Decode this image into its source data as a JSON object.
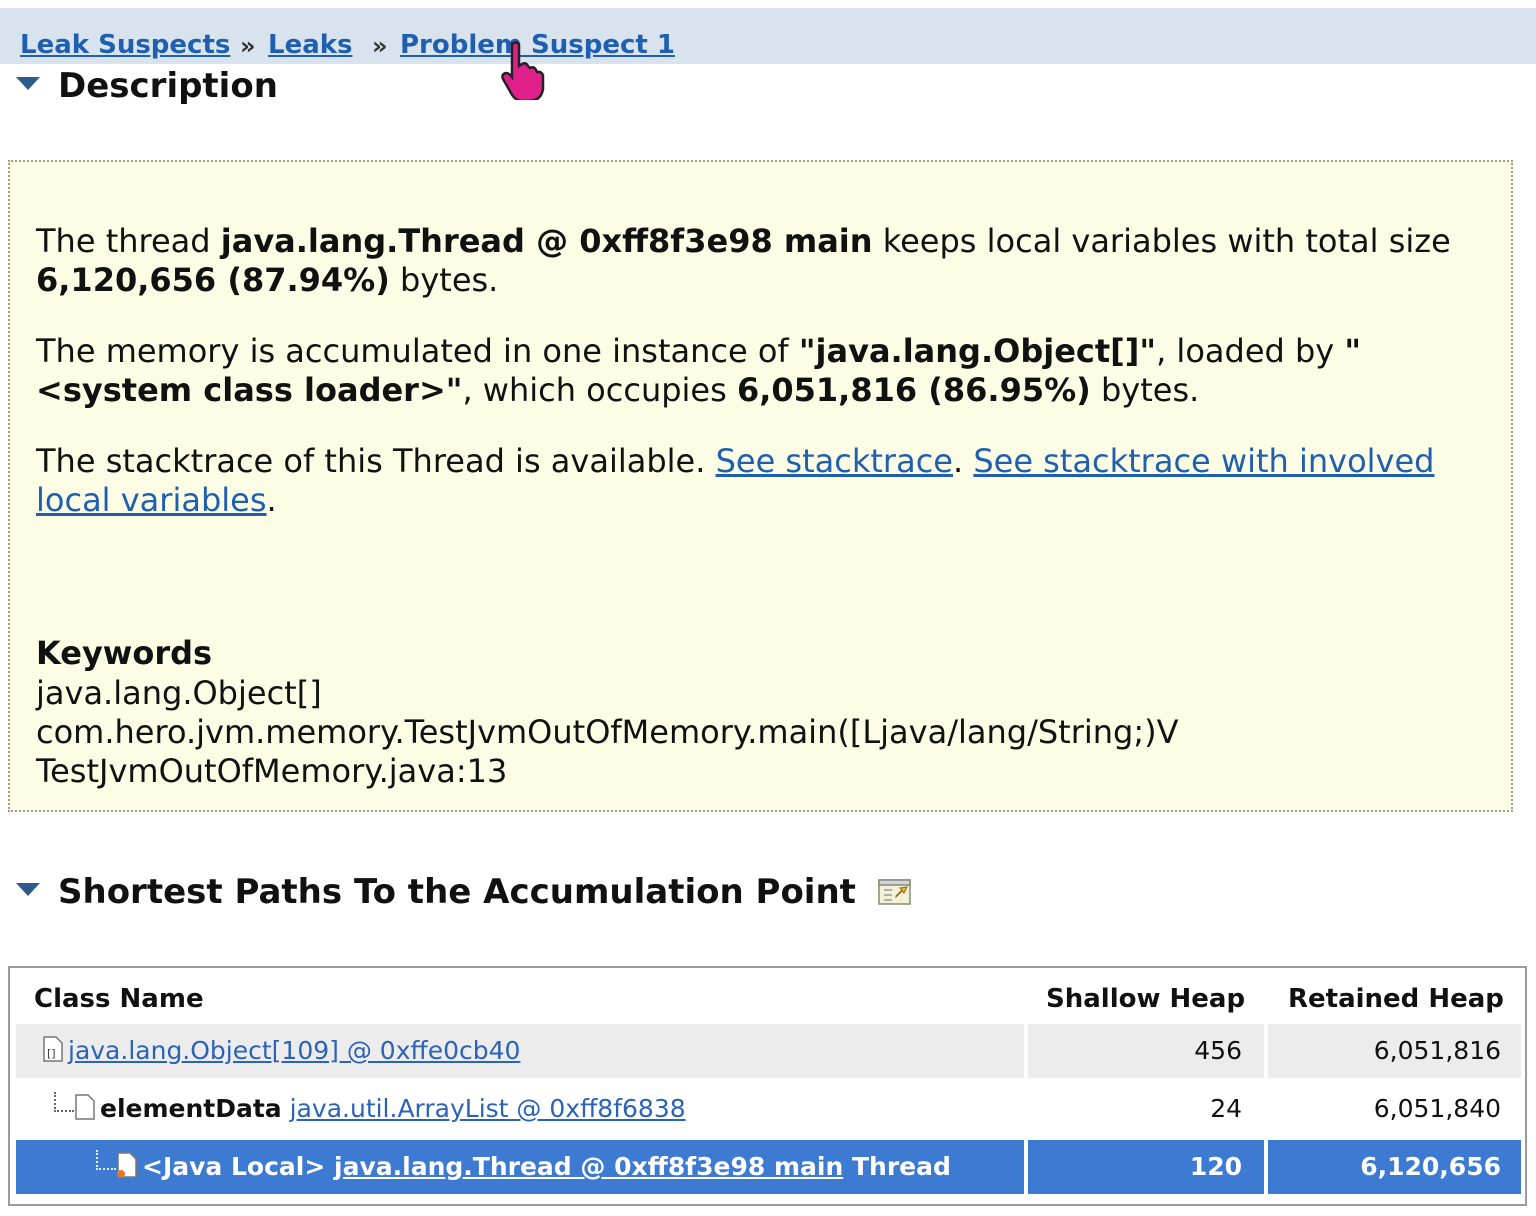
{
  "breadcrumb": {
    "items": [
      "Leak Suspects",
      "Leaks",
      "Problem Suspect 1"
    ],
    "separator": "»"
  },
  "description": {
    "title": "Description",
    "p1": {
      "t1": "The thread ",
      "b1": "java.lang.Thread @ 0xff8f3e98 main",
      "t2": " keeps local variables with total size ",
      "b2": "6,120,656 (87.94%)",
      "t3": " bytes."
    },
    "p2": {
      "t1": "The memory is accumulated in one instance of ",
      "b1": "\"java.lang.Object[]\"",
      "t2": ", loaded by ",
      "b2": "\"<system class loader>\"",
      "t3": ", which occupies ",
      "b3": "6,051,816 (86.95%)",
      "t4": " bytes."
    },
    "p3": {
      "t1": "The stacktrace of this Thread is available. ",
      "link1": "See stacktrace",
      "t2": ". ",
      "link2": "See stacktrace with involved local variables",
      "t3": "."
    },
    "keywords": {
      "title": "Keywords",
      "items": [
        "java.lang.Object[]",
        "com.hero.jvm.memory.TestJvmOutOfMemory.main([Ljava/lang/String;)V",
        "TestJvmOutOfMemory.java:13"
      ]
    }
  },
  "paths": {
    "title": "Shortest Paths To the Accumulation Point",
    "columns": [
      "Class Name",
      "Shallow Heap",
      "Retained Heap"
    ],
    "rows": [
      {
        "prefix": "",
        "link": "java.lang.Object[109] @ 0xffe0cb40",
        "suffix": "",
        "shallow": "456",
        "retained": "6,051,816"
      },
      {
        "prefix": "elementData",
        "link": "java.util.ArrayList @ 0xff8f6838",
        "suffix": "",
        "shallow": "24",
        "retained": "6,051,840"
      },
      {
        "prefix": "<Java Local>",
        "link": "java.lang.Thread @ 0xff8f3e98 main",
        "suffix": "Thread",
        "shallow": "120",
        "retained": "6,120,656"
      }
    ]
  },
  "colors": {
    "selection": "#3d7bd3",
    "description_bg": "#fdfde6",
    "breadcrumb_bg": "#d9e3ee",
    "link": "#1f5fb0"
  },
  "icons": [
    "hand-cursor-icon",
    "collapse-triangle-icon",
    "paths-view-icon",
    "array-icon",
    "object-icon"
  ]
}
